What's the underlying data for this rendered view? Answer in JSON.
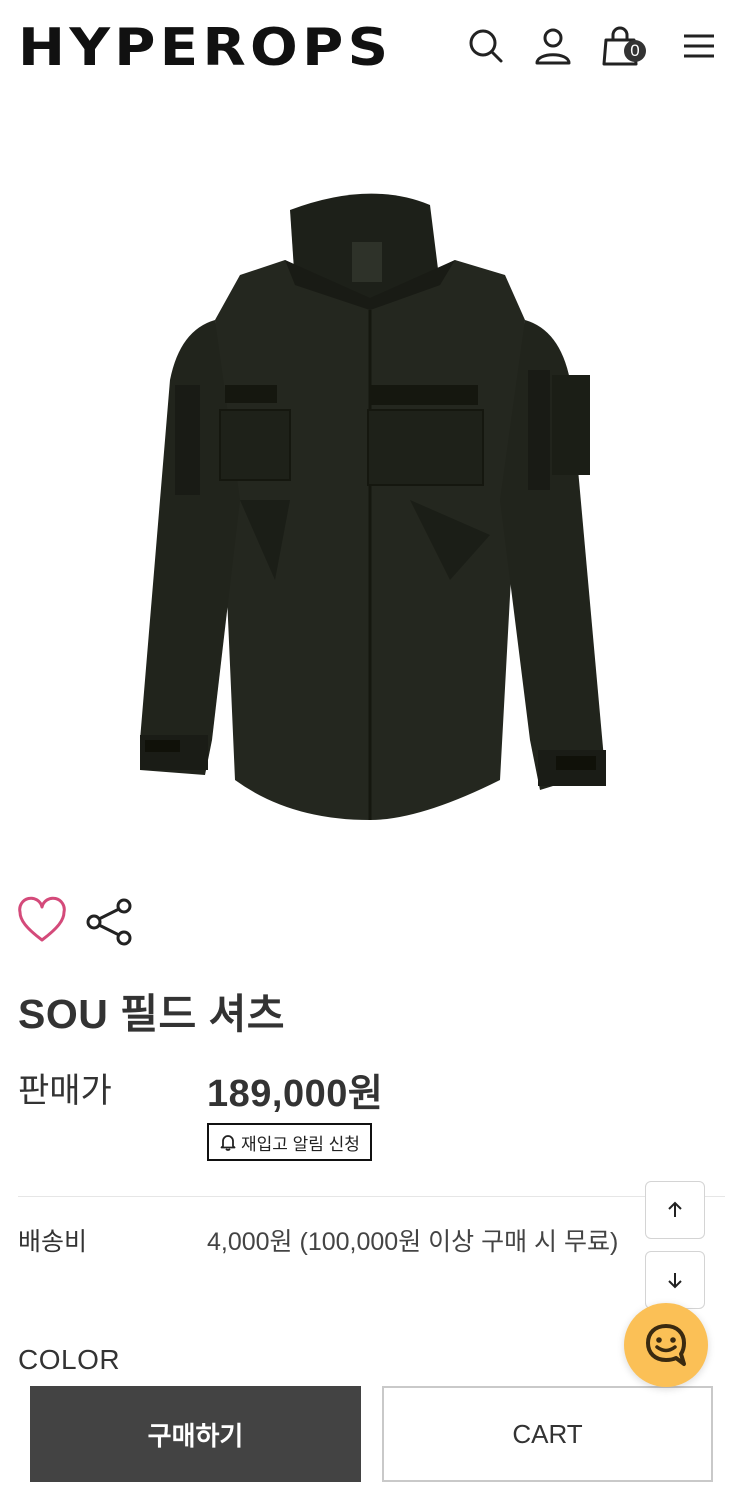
{
  "header": {
    "logo": "HYPEROPS",
    "cart_count": "0",
    "icons": [
      "search-icon",
      "user-icon",
      "cart-icon",
      "menu-icon"
    ]
  },
  "product": {
    "image_alt": "SOU 필드 셔츠",
    "name": "SOU 필드 셔츠",
    "price_label": "판매가",
    "price": "189,000원",
    "restock_label": "재입고 알림 신청",
    "shipping_label": "배송비",
    "shipping_value": "4,000원 (100,000원 이상 구매 시 무료)",
    "option_label": "COLOR"
  },
  "actions": {
    "buy": "구매하기",
    "cart": "CART"
  },
  "colors": {
    "heart": "#d44a7a",
    "buy_bg": "#434343",
    "chat_bg": "#fbc056"
  }
}
